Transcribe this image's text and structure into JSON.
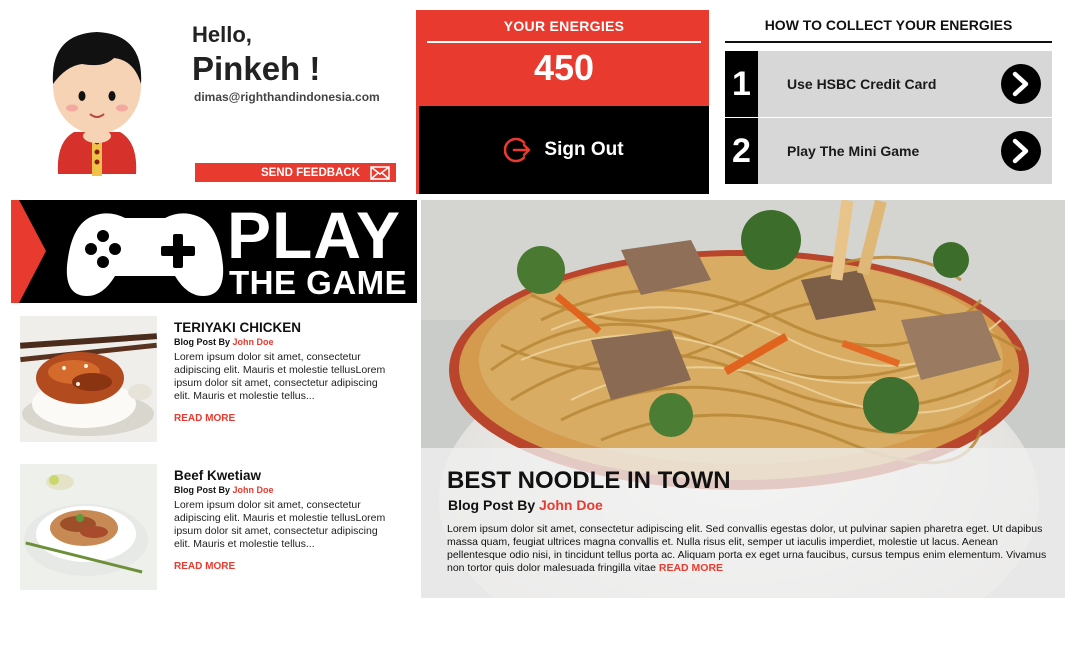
{
  "profile": {
    "greeting": "Hello,",
    "name": "Pinkeh !",
    "email": "dimas@righthandindonesia.com",
    "feedback_label": "SEND FEEDBACK"
  },
  "energies": {
    "label": "YOUR ENERGIES",
    "value": "450",
    "signout_label": "Sign Out"
  },
  "collect": {
    "title": "HOW TO COLLECT YOUR ENERGIES",
    "items": [
      {
        "num": "1",
        "label": "Use HSBC Credit Card"
      },
      {
        "num": "2",
        "label": "Play The Mini Game"
      }
    ]
  },
  "play": {
    "word": "PLAY",
    "sub": "THE GAME"
  },
  "posts": [
    {
      "title": "TERIYAKI CHICKEN",
      "by": "Blog Post By",
      "author": "John Doe",
      "text": "Lorem ipsum dolor sit amet, consectetur adipiscing elit. Mauris et molestie tellusLorem ipsum dolor sit amet, consectetur adipiscing elit. Mauris et molestie tellus...",
      "read_more": "READ MORE"
    },
    {
      "title": "Beef Kwetiaw",
      "by": "Blog Post By",
      "author": "John Doe",
      "text": "Lorem ipsum dolor sit amet, consectetur adipiscing elit. Mauris et molestie tellusLorem ipsum dolor sit amet, consectetur adipiscing elit. Mauris et molestie tellus...",
      "read_more": "READ MORE"
    }
  ],
  "hero": {
    "title": "BEST NOODLE IN TOWN",
    "by": "Blog Post By",
    "author": "John Doe",
    "text": "Lorem ipsum dolor sit amet, consectetur adipiscing elit. Sed convallis egestas dolor, ut pulvinar sapien pharetra eget. Ut dapibus massa quam, feugiat ultrices magna convallis et. Nulla risus elit, semper ut iaculis imperdiet, molestie ut lacus. Aenean pellentesque odio nisi, in tincidunt tellus porta ac. Aliquam porta ex eget urna faucibus, cursus tempus enim elementum. Vivamus non tortor quis dolor malesuada fringilla vitae",
    "read_more": "READ MORE"
  },
  "colors": {
    "accent": "#e83a2e",
    "dark": "#000000",
    "panel": "#d7d7d7"
  },
  "icons": [
    "avatar-boy-illustration",
    "envelope-icon",
    "sign-out-icon",
    "arrow-right-circle-icon",
    "gamepad-icon"
  ]
}
